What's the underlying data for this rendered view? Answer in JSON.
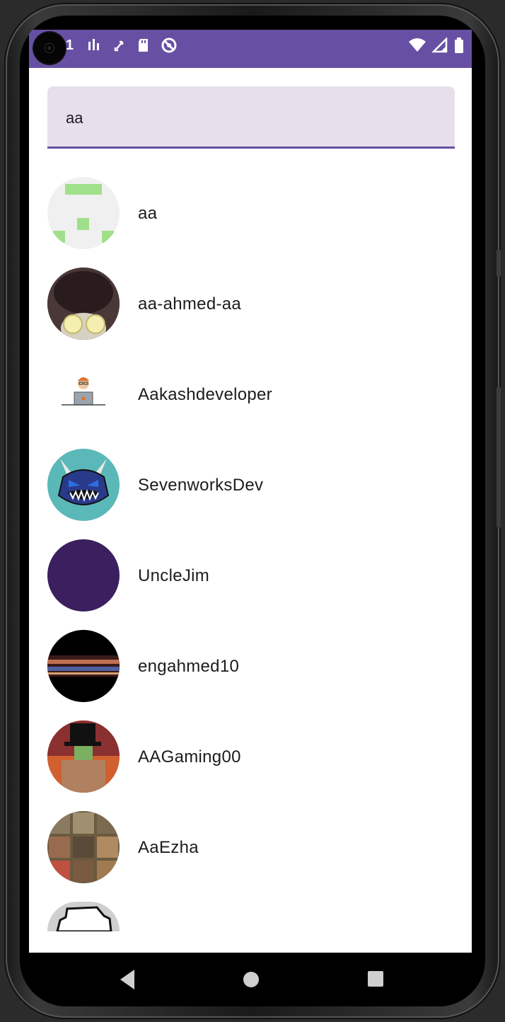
{
  "status_bar": {
    "time": "7:41",
    "left_icons": [
      "sim-signal-icon",
      "sync-icon",
      "sd-card-icon",
      "no-disturb-icon"
    ],
    "right_icons": [
      "wifi-icon",
      "cell-signal-icon",
      "battery-icon"
    ],
    "color": "#6750A4"
  },
  "search": {
    "value": "aa"
  },
  "results": [
    {
      "username": "aa",
      "avatar": "identicon"
    },
    {
      "username": "aa-ahmed-aa",
      "avatar": "photo"
    },
    {
      "username": "Aakashdeveloper",
      "avatar": "developer-illustration"
    },
    {
      "username": "SevenworksDev",
      "avatar": "monster-face"
    },
    {
      "username": "UncleJim",
      "avatar": "solid-purple"
    },
    {
      "username": "engahmed10",
      "avatar": "dark-photo"
    },
    {
      "username": "AAGaming00",
      "avatar": "cartoon-character"
    },
    {
      "username": "AaEzha",
      "avatar": "monkey-grid"
    },
    {
      "username": "",
      "avatar": "partial"
    }
  ],
  "navigation": {
    "back": "back-icon",
    "home": "home-icon",
    "recents": "recents-icon"
  }
}
